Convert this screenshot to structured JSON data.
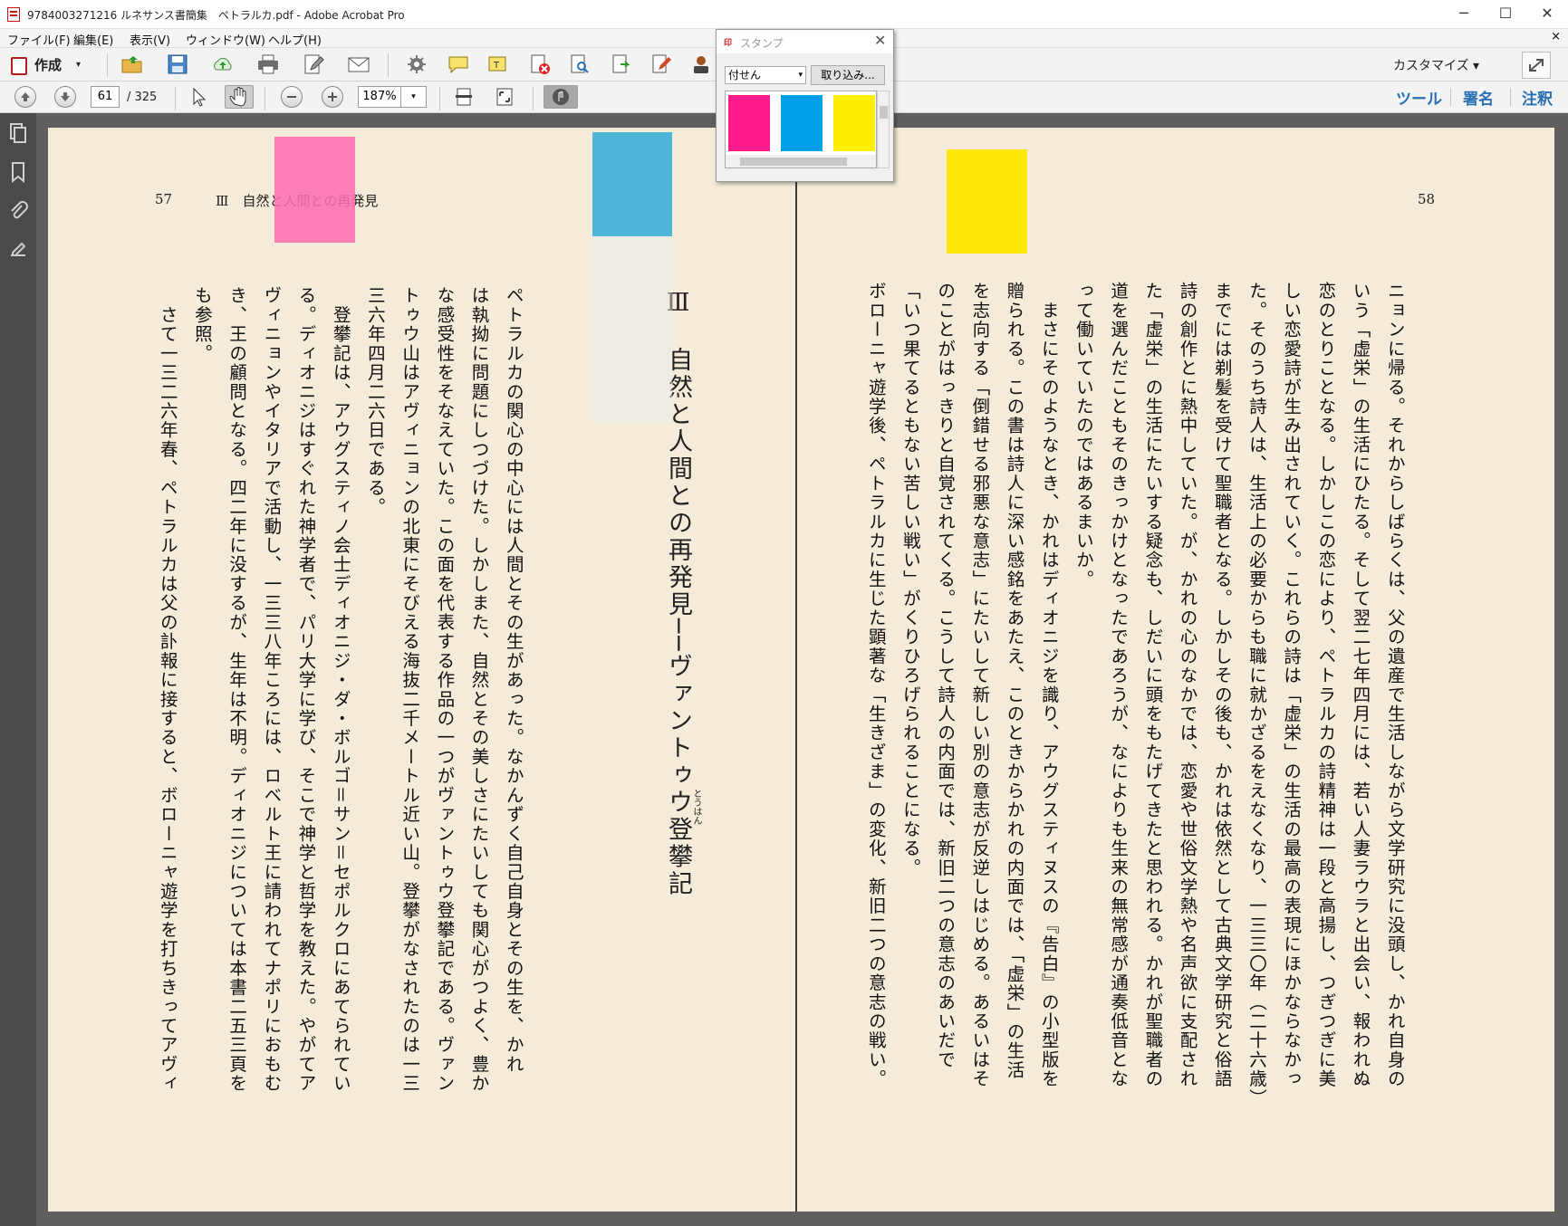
{
  "window": {
    "title": "9784003271216 ルネサンス書簡集　ペトラルカ.pdf - Adobe Acrobat Pro",
    "minimize": "─",
    "maximize": "☐",
    "close": "✕"
  },
  "menu": {
    "items": [
      "ファイル(F)",
      "編集(E)",
      "表示(V)",
      "ウィンドウ(W)",
      "ヘルプ(H)"
    ],
    "close_doc": "×"
  },
  "toolbar": {
    "create_label": "作成",
    "create_caret": "▾",
    "customize_label": "カスタマイズ ▾",
    "icons": [
      "open-folder-icon",
      "save-icon",
      "cloud-upload-icon",
      "print-icon",
      "edit-icon",
      "email-icon",
      "settings-icon",
      "comment-icon",
      "highlight-icon",
      "delete-icon",
      "search-doc-icon",
      "export-icon",
      "sign-icon",
      "stamp-user-icon"
    ]
  },
  "navbar": {
    "page_current": "61",
    "page_total": "/ 325",
    "zoom": "187%",
    "zoom_caret": "▾",
    "tabs": [
      "ツール",
      "署名",
      "注釈"
    ],
    "accent_color": "#2a6fb4"
  },
  "stamp_palette": {
    "title": "スタンプ",
    "title_icon": "印",
    "close": "✕",
    "category": "付せん",
    "category_caret": "▾",
    "import_label": "取り込み...",
    "swatches": [
      "#ff1a8c",
      "#00a0e8",
      "#ffee00"
    ]
  },
  "document": {
    "left_page": {
      "page_number": "57",
      "running_head": "Ⅲ　自然と人間との再発見",
      "chapter_title": "Ⅲ　自然と人間との再発見──ヴァントゥウ登攀記",
      "ruby": "とうはん",
      "body": "ペトラルカの関心の中心には人間とその生があった。なかんずく自己自身とその生を、かれ\nは執拗に問題にしつづけた。しかしまた、自然とその美しさにたいしても関心がつよく、豊か\nな感受性をそなえていた。この面を代表する作品の一つがヴァントゥウ登攀記である。ヴァン\nトゥウ山はアヴィニョンの北東にそびえる海抜二千メートル近い山。登攀がなされたのは一三\n三六年四月二六日である。\n　登攀記は、アウグスティノ会士ディオニジ・ダ・ボルゴ＝サン＝セポルクロにあてられてい\nる。ディオニジはすぐれた神学者で、パリ大学に学び、そこで神学と哲学を教えた。やがてア\nヴィニョンやイタリアで活動し、一三三八年ころには、ロベルト王に請われてナポリにおもむ\nき、王の顧問となる。四二年に没するが、生年は不明。ディオニジについては本書二五三頁を\nも参照。\n　さて一三二六年春、ペトラルカは父の訃報に接すると、ボローニャ遊学を打ちきってアヴィ"
    },
    "right_page": {
      "page_number": "58",
      "body": "ニョンに帰る。それからしばらくは、父の遺産で生活しながら文学研究に没頭し、かれ自身の\nいう「虚栄」の生活にひたる。そして翌二七年四月には、若い人妻ラウラと出会い、報われぬ\n恋のとりことなる。しかしこの恋により、ペトラルカの詩精神は一段と高揚し、つぎつぎに美\nしい恋愛詩が生み出されていく。これらの詩は「虚栄」の生活の最高の表現にほかならなかっ\nた。そのうち詩人は、生活上の必要からも職に就かざるをえなくなり、一三三〇年（二十六歳）\nまでには剃髪を受けて聖職者となる。しかしその後も、かれは依然として古典文学研究と俗語\n詩の創作とに熱中していた。が、かれの心のなかでは、恋愛や世俗文学熱や名声欲に支配され\nた「虚栄」の生活にたいする疑念も、しだいに頭をもたげてきたと思われる。かれが聖職者の\n道を選んだこともそのきっかけとなったであろうが、なによりも生来の無常感が通奏低音とな\nって働いていたのではあるまいか。\n　まさにそのようなとき、かれはディオニジを識り、アウグスティヌスの『告白』の小型版を\n贈られる。この書は詩人に深い感銘をあたえ、このときからかれの内面では、「虚栄」の生活\nを志向する「倒錯せる邪悪な意志」にたいして新しい別の意志が反逆しはじめる。あるいはそ\nのことがはっきりと自覚されてくる。こうして詩人の内面では、新旧二つの意志のあいだで\n「いつ果てるともない苦しい戦い」がくりひろげられることになる。\nボローニャ遊学後、ペトラルカに生じた顕著な「生きざま」の変化、新旧二つの意志の戦い。"
    },
    "sticky_notes": [
      {
        "color": "#ff7ab8",
        "name": "pink-sticky-note"
      },
      {
        "color": "#4fb8d9",
        "name": "blue-sticky-note"
      },
      {
        "color": "#ffee00",
        "name": "yellow-sticky-note"
      }
    ]
  }
}
